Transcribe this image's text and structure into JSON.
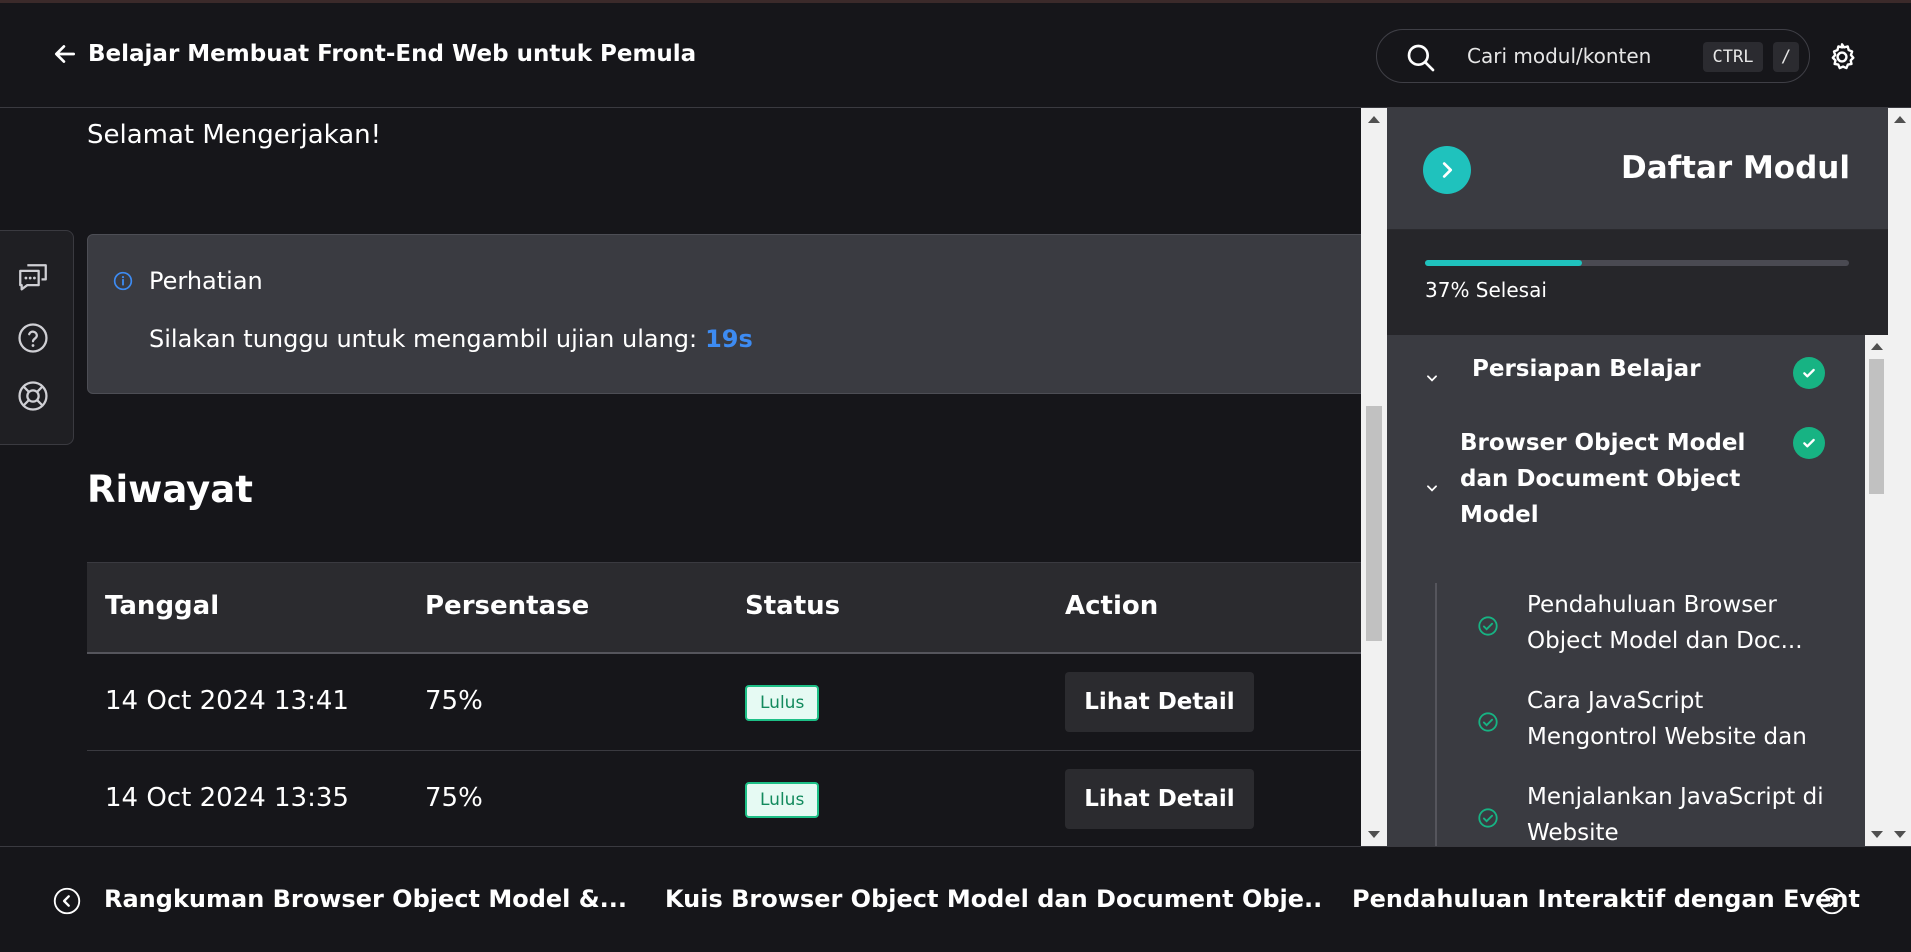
{
  "header": {
    "course_title": "Belajar Membuat Front-End Web untuk Pemula",
    "search_placeholder": "Cari modul/konten",
    "kbd_ctrl": "CTRL",
    "kbd_slash": "/"
  },
  "main": {
    "greeting": "Selamat Mengerjakan!",
    "notice": {
      "title": "Perhatian",
      "message": "Silakan tunggu untuk mengambil ujian ulang:",
      "countdown": "19s"
    },
    "history_title": "Riwayat",
    "table": {
      "columns": [
        "Tanggal",
        "Persentase",
        "Status",
        "Action"
      ],
      "rows": [
        {
          "date": "14 Oct 2024 13:41",
          "percent": "75%",
          "status": "Lulus",
          "action": "Lihat Detail"
        },
        {
          "date": "14 Oct 2024 13:35",
          "percent": "75%",
          "status": "Lulus",
          "action": "Lihat Detail"
        }
      ]
    }
  },
  "sidebar": {
    "title": "Daftar Modul",
    "progress_value": 0.37,
    "progress_label": "37% Selesai",
    "modules": [
      {
        "name": "Persiapan Belajar",
        "completed": true
      },
      {
        "name_lines": [
          "Browser Object Model",
          "dan Document Object",
          "Model"
        ],
        "completed": true
      }
    ],
    "submodules": [
      {
        "lines": [
          "Pendahuluan Browser",
          "Object Model dan Doc..."
        ]
      },
      {
        "lines": [
          "Cara JavaScript",
          "Mengontrol Website dan"
        ]
      },
      {
        "lines": [
          "Menjalankan JavaScript di",
          "Website"
        ]
      }
    ]
  },
  "footer": {
    "prev": "Rangkuman Browser Object Model &...",
    "current": "Kuis Browser Object Model dan Document Obje..",
    "next": "Pendahuluan Interaktif dengan Event"
  },
  "colors": {
    "accent": "#1fc2bd",
    "success": "#17b383",
    "countdown": "#3d8bf2"
  },
  "icons": [
    "arrow-left-icon",
    "search-icon",
    "gear-icon",
    "chat-icon",
    "help-icon",
    "support-icon",
    "info-icon",
    "chevron-right-icon",
    "chevron-down-icon",
    "check-icon",
    "chevron-left-icon"
  ]
}
